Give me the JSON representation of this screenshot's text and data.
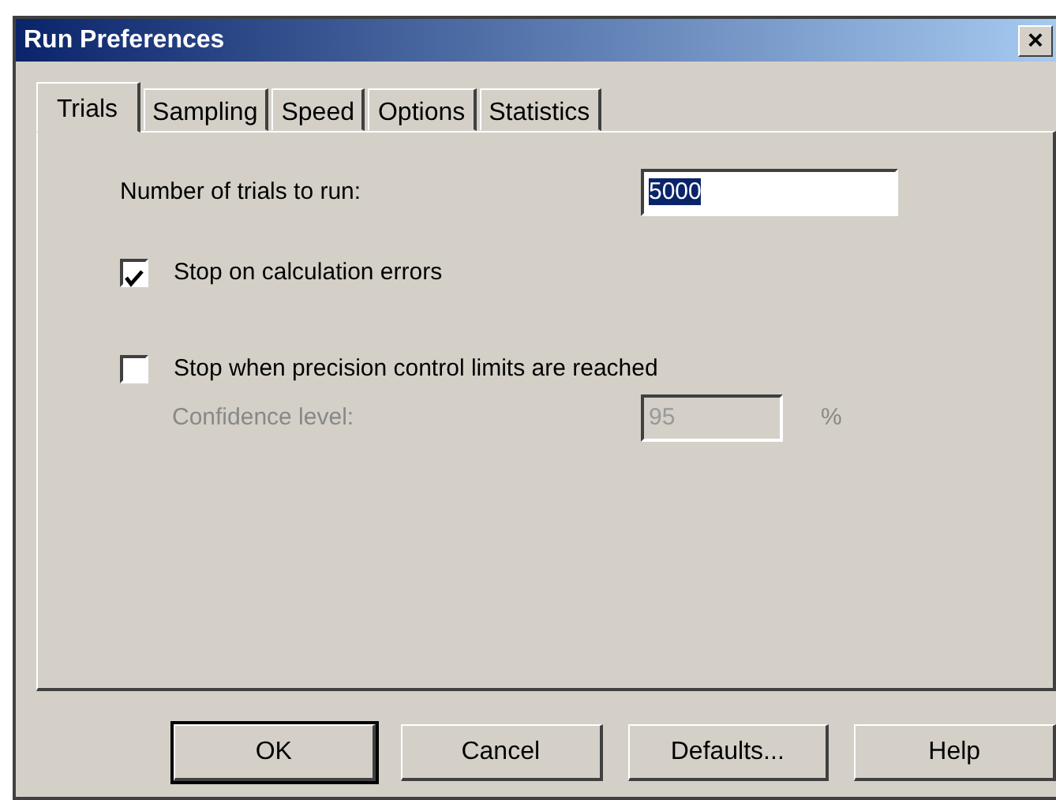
{
  "window": {
    "title": "Run Preferences",
    "close": "×"
  },
  "tabs": [
    {
      "label": "Trials",
      "selected": true
    },
    {
      "label": "Sampling",
      "selected": false
    },
    {
      "label": "Speed",
      "selected": false
    },
    {
      "label": "Options",
      "selected": false
    },
    {
      "label": "Statistics",
      "selected": false
    }
  ],
  "trials_field": {
    "label": "Number of trials to run:",
    "value": "5000",
    "highlighted": true
  },
  "checkboxes": [
    {
      "label": "Stop on calculation errors",
      "checked": true
    },
    {
      "label": "Stop when precision control limits are reached",
      "checked": false
    }
  ],
  "confidence": {
    "label": "Confidence level:",
    "value": "95",
    "unit": "%",
    "disabled": true
  },
  "buttons": [
    {
      "label": "OK",
      "default": true
    },
    {
      "label": "Cancel",
      "default": false
    },
    {
      "label": "Defaults...",
      "default": false
    },
    {
      "label": "Help",
      "default": false
    }
  ]
}
